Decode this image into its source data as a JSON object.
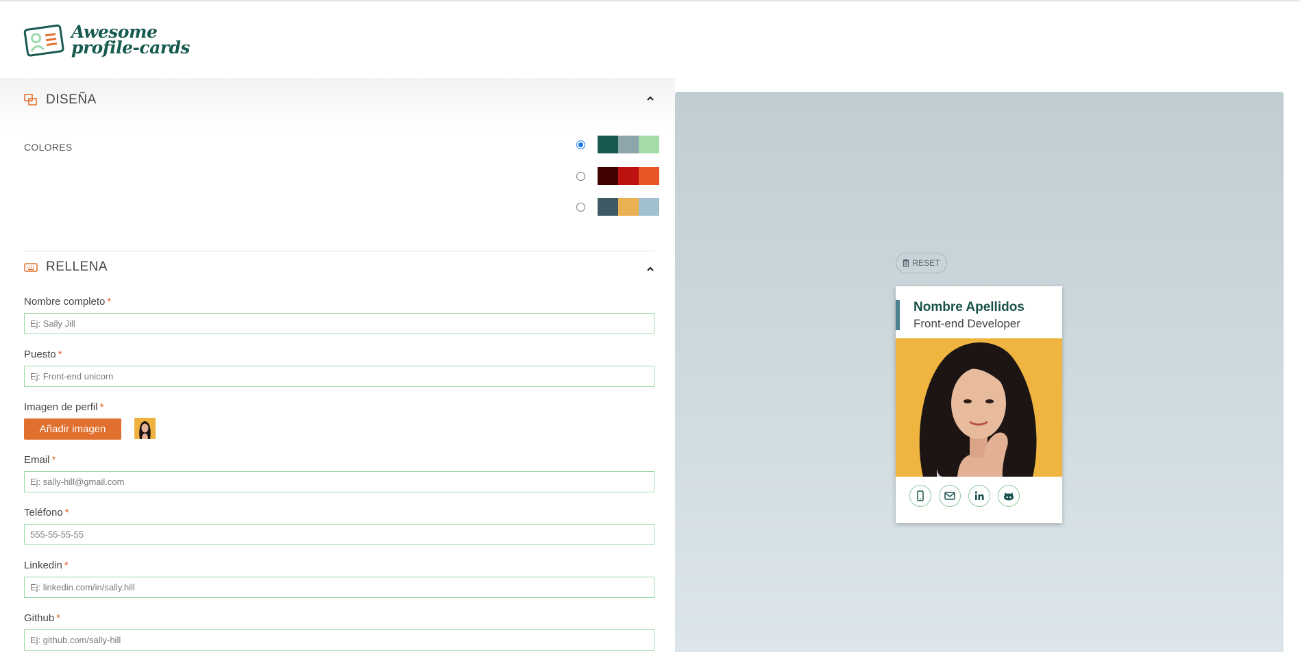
{
  "header": {
    "logo_line1": "Awesome",
    "logo_line2": "profile-cards"
  },
  "design": {
    "title": "DISEÑA",
    "colors_label": "COLORES",
    "palettes": [
      {
        "selected": true,
        "colors": [
          "#1a5951",
          "#8ea5ab",
          "#a4dca9"
        ]
      },
      {
        "selected": false,
        "colors": [
          "#420101",
          "#be1111",
          "#e95626"
        ]
      },
      {
        "selected": false,
        "colors": [
          "#3e5b65",
          "#eab052",
          "#a0c0cf"
        ]
      }
    ]
  },
  "fill": {
    "title": "RELLENA",
    "required_mark": "*",
    "fields": {
      "name": {
        "label": "Nombre completo",
        "placeholder": "Ej: Sally Jill"
      },
      "job": {
        "label": "Puesto",
        "placeholder": "Ej: Front-end unicorn"
      },
      "image": {
        "label": "Imagen de perfil",
        "button": "Añadir imagen"
      },
      "email": {
        "label": "Email",
        "placeholder": "Ej: sally-hill@gmail.com"
      },
      "phone": {
        "label": "Teléfono",
        "placeholder": "555-55-55-55"
      },
      "linkedin": {
        "label": "Linkedin",
        "placeholder": "Ej: linkedin.com/in/sally.hill"
      },
      "github": {
        "label": "Github",
        "placeholder": "Ej: github.com/sally-hill"
      }
    }
  },
  "preview": {
    "reset_label": "RESET",
    "card": {
      "name": "Nombre Apellidos",
      "job": "Front-end Developer",
      "accent": "#4b8090",
      "socials": [
        "mobile-icon",
        "envelope-icon",
        "linkedin-icon",
        "github-icon"
      ]
    }
  }
}
